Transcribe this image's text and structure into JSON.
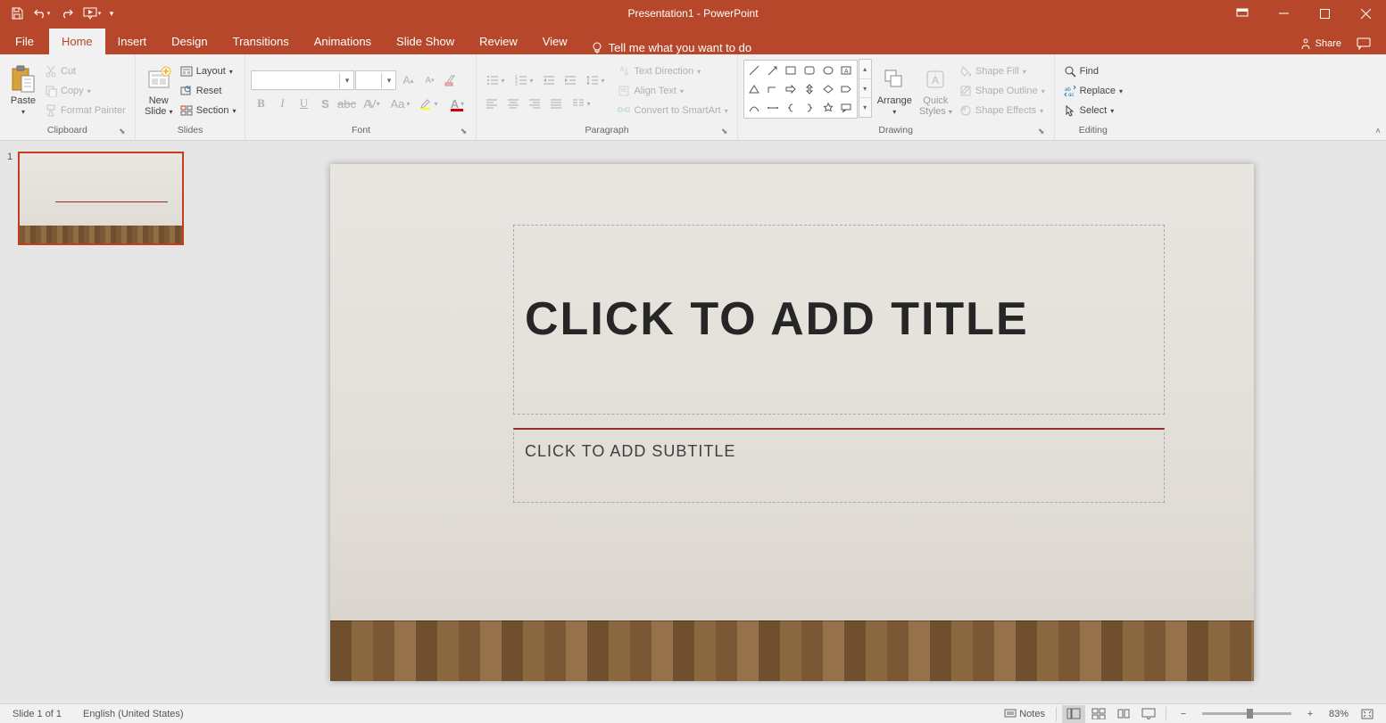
{
  "title": "Presentation1 - PowerPoint",
  "qa": {
    "save": "Save",
    "undo": "Undo",
    "redo": "Redo",
    "start": "Start From Beginning"
  },
  "tabs": {
    "file": "File",
    "home": "Home",
    "insert": "Insert",
    "design": "Design",
    "transitions": "Transitions",
    "animations": "Animations",
    "slideshow": "Slide Show",
    "review": "Review",
    "view": "View"
  },
  "tellme": "Tell me what you want to do",
  "share": "Share",
  "ribbon": {
    "clipboard": {
      "label": "Clipboard",
      "paste": "Paste",
      "cut": "Cut",
      "copy": "Copy",
      "format_painter": "Format Painter"
    },
    "slides": {
      "label": "Slides",
      "new_slide": "New\nSlide",
      "layout": "Layout",
      "reset": "Reset",
      "section": "Section"
    },
    "font": {
      "label": "Font"
    },
    "paragraph": {
      "label": "Paragraph",
      "text_direction": "Text Direction",
      "align_text": "Align Text",
      "convert_smartart": "Convert to SmartArt"
    },
    "drawing": {
      "label": "Drawing",
      "arrange": "Arrange",
      "quick_styles": "Quick\nStyles",
      "shape_fill": "Shape Fill",
      "shape_outline": "Shape Outline",
      "shape_effects": "Shape Effects"
    },
    "editing": {
      "label": "Editing",
      "find": "Find",
      "replace": "Replace",
      "select": "Select"
    }
  },
  "thumb_num": "1",
  "slide": {
    "title_placeholder": "CLICK TO ADD TITLE",
    "subtitle_placeholder": "CLICK TO ADD SUBTITLE"
  },
  "status": {
    "slide": "Slide 1 of 1",
    "lang": "English (United States)",
    "notes": "Notes",
    "zoom": "83%"
  }
}
